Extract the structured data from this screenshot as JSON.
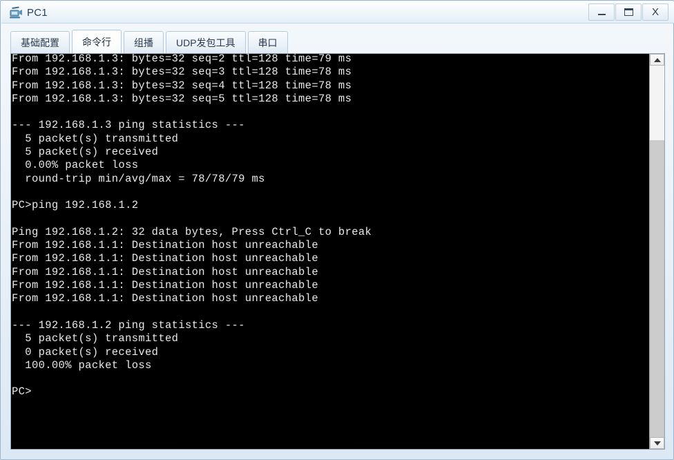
{
  "window": {
    "title": "PC1",
    "icon": "pc-device-icon",
    "buttons": {
      "minimize": "minimize",
      "maximize": "maximize",
      "close": "X"
    }
  },
  "tabs": [
    {
      "label": "基础配置",
      "active": false,
      "name": "tab-basic-config"
    },
    {
      "label": "命令行",
      "active": true,
      "name": "tab-command-line"
    },
    {
      "label": "组播",
      "active": false,
      "name": "tab-multicast"
    },
    {
      "label": "UDP发包工具",
      "active": false,
      "name": "tab-udp-tool"
    },
    {
      "label": "串口",
      "active": false,
      "name": "tab-serial-port"
    }
  ],
  "terminal": {
    "background": "#000000",
    "foreground": "#e8e8e8",
    "lines": [
      "From 192.168.1.3: bytes=32 seq=2 ttl=128 time=79 ms",
      "From 192.168.1.3: bytes=32 seq=3 ttl=128 time=78 ms",
      "From 192.168.1.3: bytes=32 seq=4 ttl=128 time=78 ms",
      "From 192.168.1.3: bytes=32 seq=5 ttl=128 time=78 ms",
      "",
      "--- 192.168.1.3 ping statistics ---",
      "  5 packet(s) transmitted",
      "  5 packet(s) received",
      "  0.00% packet loss",
      "  round-trip min/avg/max = 78/78/79 ms",
      "",
      "PC>ping 192.168.1.2",
      "",
      "Ping 192.168.1.2: 32 data bytes, Press Ctrl_C to break",
      "From 192.168.1.1: Destination host unreachable",
      "From 192.168.1.1: Destination host unreachable",
      "From 192.168.1.1: Destination host unreachable",
      "From 192.168.1.1: Destination host unreachable",
      "From 192.168.1.1: Destination host unreachable",
      "",
      "--- 192.168.1.2 ping statistics ---",
      "  5 packet(s) transmitted",
      "  0 packet(s) received",
      "  100.00% packet loss",
      "",
      "PC>"
    ]
  },
  "scrollbar": {
    "up_arrow": "scroll-up",
    "down_arrow": "scroll-down",
    "thumb_top_pct": 20,
    "thumb_height_pct": 80
  }
}
